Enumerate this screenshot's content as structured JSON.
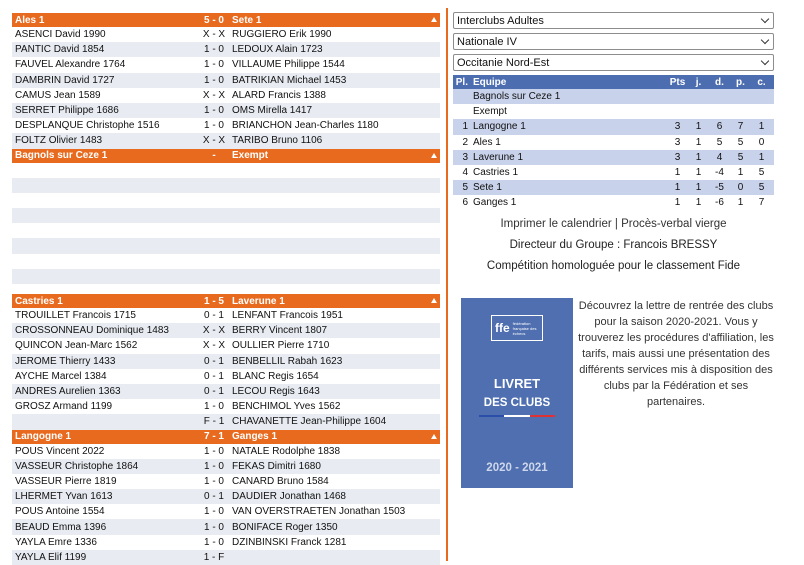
{
  "matches": [
    {
      "home": "Ales 1",
      "score": "5 - 0",
      "away": "Sete 1",
      "boards": [
        {
          "home": "ASENCI David 1990",
          "score": "X - X",
          "away": "RUGGIERO Erik 1990"
        },
        {
          "home": "PANTIC David 1854",
          "score": "1 - 0",
          "away": "LEDOUX Alain 1723"
        },
        {
          "home": "FAUVEL Alexandre 1764",
          "score": "1 - 0",
          "away": "VILLAUME Philippe 1544"
        },
        {
          "home": "DAMBRIN David 1727",
          "score": "1 - 0",
          "away": "BATRIKIAN Michael 1453"
        },
        {
          "home": "CAMUS Jean 1589",
          "score": "X - X",
          "away": "ALARD Francis 1388"
        },
        {
          "home": "SERRET Philippe 1686",
          "score": "1 - 0",
          "away": "OMS Mirella 1417"
        },
        {
          "home": "DESPLANQUE Christophe 1516",
          "score": "1 - 0",
          "away": "BRIANCHON Jean-Charles 1180"
        },
        {
          "home": "FOLTZ Olivier 1483",
          "score": "X - X",
          "away": "TARIBO Bruno 1106"
        }
      ]
    },
    {
      "home": "Bagnols sur Ceze 1",
      "score": "-",
      "away": "Exempt",
      "boards": [
        {
          "home": "",
          "score": "",
          "away": ""
        },
        {
          "home": "",
          "score": "",
          "away": ""
        },
        {
          "home": "",
          "score": "",
          "away": ""
        },
        {
          "home": "",
          "score": "",
          "away": ""
        },
        {
          "home": "",
          "score": "",
          "away": ""
        },
        {
          "home": "",
          "score": "",
          "away": ""
        },
        {
          "home": "",
          "score": "",
          "away": ""
        },
        {
          "home": "",
          "score": "",
          "away": ""
        }
      ]
    },
    {
      "home": "Castries 1",
      "score": "1 - 5",
      "away": "Laverune 1",
      "boards": [
        {
          "home": "TROUILLET Francois 1715",
          "score": "0 - 1",
          "away": "LENFANT Francois 1951"
        },
        {
          "home": "CROSSONNEAU Dominique 1483",
          "score": "X - X",
          "away": "BERRY Vincent 1807"
        },
        {
          "home": "QUINCON Jean-Marc 1562",
          "score": "X - X",
          "away": "OULLIER Pierre 1710"
        },
        {
          "home": "JEROME Thierry 1433",
          "score": "0 - 1",
          "away": "BENBELLIL Rabah 1623"
        },
        {
          "home": "AYCHE Marcel 1384",
          "score": "0 - 1",
          "away": "BLANC Regis 1654"
        },
        {
          "home": "ANDRES Aurelien 1363",
          "score": "0 - 1",
          "away": "LECOU Regis 1643"
        },
        {
          "home": "GROSZ Armand 1199",
          "score": "1 - 0",
          "away": "BENCHIMOL Yves 1562"
        },
        {
          "home": "",
          "score": "F - 1",
          "away": "CHAVANETTE Jean-Philippe 1604"
        }
      ]
    },
    {
      "home": "Langogne 1",
      "score": "7 - 1",
      "away": "Ganges 1",
      "boards": [
        {
          "home": "POUS Vincent 2022",
          "score": "1 - 0",
          "away": "NATALE Rodolphe 1838"
        },
        {
          "home": "VASSEUR Christophe 1864",
          "score": "1 - 0",
          "away": "FEKAS Dimitri 1680"
        },
        {
          "home": "VASSEUR Pierre 1819",
          "score": "1 - 0",
          "away": "CANARD Bruno 1584"
        },
        {
          "home": "LHERMET Yvan 1613",
          "score": "0 - 1",
          "away": "DAUDIER Jonathan 1468"
        },
        {
          "home": "POUS Antoine 1554",
          "score": "1 - 0",
          "away": "VAN OVERSTRAETEN Jonathan 1503"
        },
        {
          "home": "BEAUD Emma 1396",
          "score": "1 - 0",
          "away": "BONIFACE Roger 1350"
        },
        {
          "home": "YAYLA Emre 1336",
          "score": "1 - 0",
          "away": "DZINBINSKI Franck 1281"
        },
        {
          "home": "YAYLA Elif 1199",
          "score": "1 - F",
          "away": ""
        }
      ]
    }
  ],
  "selects": {
    "competition": "Interclubs Adultes",
    "division": "Nationale IV",
    "group": "Occitanie Nord-Est"
  },
  "standings": {
    "headers": {
      "pl": "Pl.",
      "equipe": "Equipe",
      "pts": "Pts",
      "j": "j.",
      "d": "d.",
      "p": "p.",
      "c": "c."
    },
    "rows": [
      {
        "pl": "",
        "equipe": "Bagnols sur Ceze 1",
        "pts": "",
        "j": "",
        "d": "",
        "p": "",
        "c": ""
      },
      {
        "pl": "",
        "equipe": "Exempt",
        "pts": "",
        "j": "",
        "d": "",
        "p": "",
        "c": ""
      },
      {
        "pl": "1",
        "equipe": "Langogne 1",
        "pts": "3",
        "j": "1",
        "d": "6",
        "p": "7",
        "c": "1"
      },
      {
        "pl": "2",
        "equipe": "Ales 1",
        "pts": "3",
        "j": "1",
        "d": "5",
        "p": "5",
        "c": "0"
      },
      {
        "pl": "3",
        "equipe": "Laverune 1",
        "pts": "3",
        "j": "1",
        "d": "4",
        "p": "5",
        "c": "1"
      },
      {
        "pl": "4",
        "equipe": "Castries 1",
        "pts": "1",
        "j": "1",
        "d": "-4",
        "p": "1",
        "c": "5"
      },
      {
        "pl": "5",
        "equipe": "Sete 1",
        "pts": "1",
        "j": "1",
        "d": "-5",
        "p": "0",
        "c": "5"
      },
      {
        "pl": "6",
        "equipe": "Ganges 1",
        "pts": "1",
        "j": "1",
        "d": "-6",
        "p": "1",
        "c": "7"
      }
    ]
  },
  "links": {
    "print_calendar": "Imprimer le calendrier",
    "separator": " | ",
    "blank_report": "Procès-verbal vierge"
  },
  "director": "Directeur du Groupe : Francois BRESSY",
  "homologation": "Compétition homologuée pour le classement Fide",
  "promo": {
    "logo": "ffe",
    "logo_small": "fédération française des échecs",
    "title_line1": "LIVRET",
    "title_line2": "DES CLUBS",
    "year": "2020 - 2021",
    "text": "Découvrez la lettre de rentrée des clubs pour la saison 2020-2021. Vous y trouverez les procédures d'affiliation, les tarifs, mais aussi une présentation des différents services mis à disposition des clubs par la Fédération et ses partenaires."
  },
  "colors": {
    "accent_orange": "#e86a1e",
    "header_blue": "#4d6db1",
    "row_blue": "#c8d2ea",
    "row_grey": "#e8ecf2",
    "cover_blue": "#4f6fb0"
  }
}
